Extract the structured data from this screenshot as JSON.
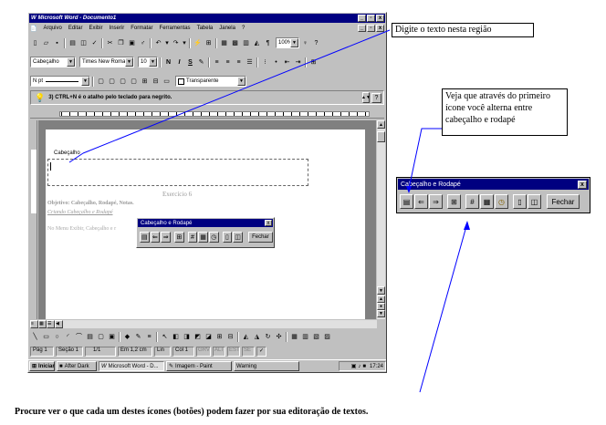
{
  "window": {
    "title": "Microsoft Word - Documento1",
    "doc_controls": [
      "_",
      "▫",
      "x"
    ],
    "app_controls": [
      "_",
      "▫",
      "x"
    ]
  },
  "menu": [
    "Arquivo",
    "Editar",
    "Exibir",
    "Inserir",
    "Formatar",
    "Ferramentas",
    "Tabela",
    "Janela",
    "?"
  ],
  "formatting": {
    "style": "Cabeçalho",
    "font": "Times New Roman",
    "size": "10",
    "bold": "N",
    "italic": "I",
    "underline": "S",
    "zoom": "100%"
  },
  "drawing_bar": {
    "line": "N pt",
    "fill": "Transparente"
  },
  "tip": {
    "text": "3) CTRL+N é o atalho pelo teclado para negrito."
  },
  "document": {
    "header_label": "Cabeçalho",
    "exercise": "Exercício 6",
    "objective": "Objetivo: Cabeçalho, Rodapé, Notas.",
    "create_link": "Criando Cabeçalho e Rodapé",
    "menu_line": "No Menu Exibir, Cabeçalho e r"
  },
  "hf_toolbar": {
    "title": "Cabeçalho e Rodapé",
    "close": "x",
    "close_button": "Fechar"
  },
  "status": {
    "page": "Pág 1",
    "section": "Seção 1",
    "pages": "1/1",
    "position": "Em 1,2 cm",
    "line": "Lin",
    "col": "Col 1",
    "modes": [
      "GRV",
      "ALT",
      "EST",
      "SE"
    ]
  },
  "taskbar": {
    "start": "Iniciar",
    "items": [
      "After Dark",
      "Microsoft Word - D...",
      "Imagem - Paint",
      "Warning"
    ],
    "clock": "17:24"
  },
  "annotations": {
    "type_here": "Digite o texto nesta região",
    "toggle": "Veja que através do primeiro ícone você alterna entre cabeçalho e rodapé",
    "bottom": "Procure ver o que cada um destes ícones (botões) podem fazer por sua editoração de textos."
  },
  "colors": {
    "titlebar": "#000080",
    "face": "#c0c0c0",
    "link": "#0000ff"
  }
}
